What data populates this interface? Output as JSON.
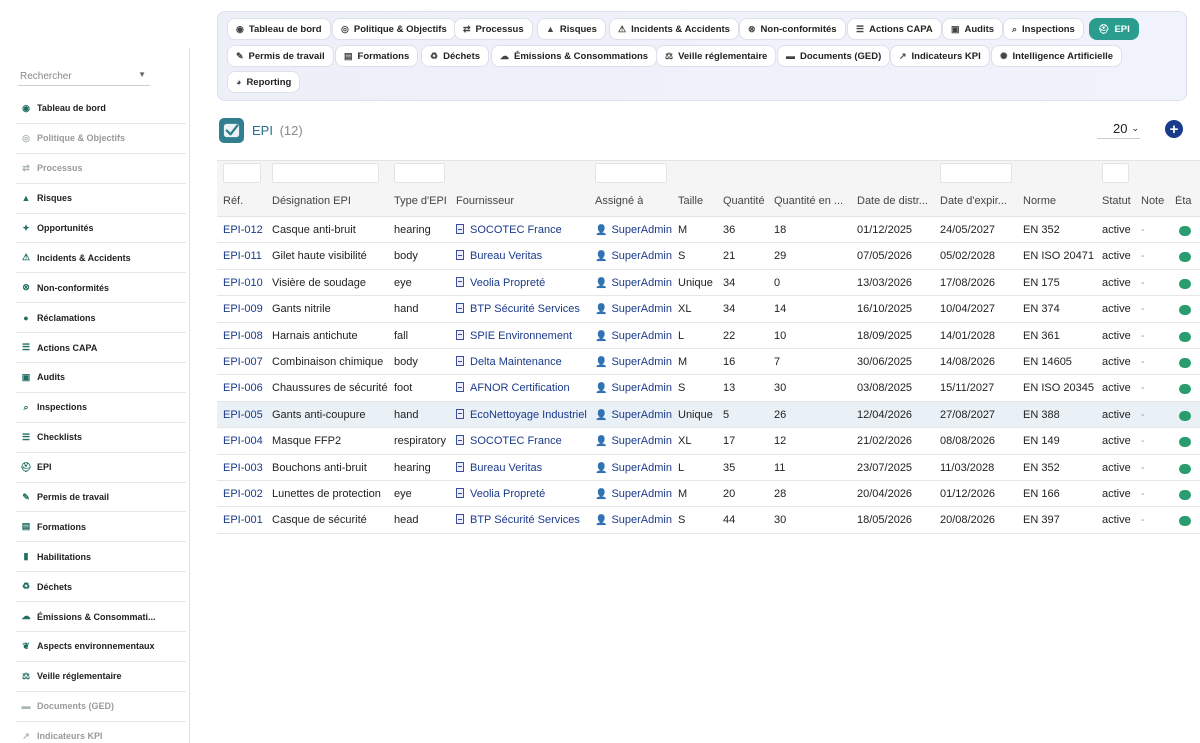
{
  "nav": {
    "items": [
      {
        "label": "Tableau de bord",
        "icon": "dashboard-icon",
        "glyph": "◉"
      },
      {
        "label": "Politique & Objectifs",
        "icon": "target-icon",
        "glyph": "◎"
      },
      {
        "label": "Processus",
        "icon": "process-icon",
        "glyph": "⇄"
      },
      {
        "label": "Risques",
        "icon": "warning-icon",
        "glyph": "▲"
      },
      {
        "label": "Incidents & Accidents",
        "icon": "incident-icon",
        "glyph": "⚠"
      },
      {
        "label": "Non-conformités",
        "icon": "x-circle-icon",
        "glyph": "⊗"
      },
      {
        "label": "Actions CAPA",
        "icon": "list-icon",
        "glyph": "☰"
      },
      {
        "label": "Audits",
        "icon": "clipboard-icon",
        "glyph": "▣"
      },
      {
        "label": "Inspections",
        "icon": "search-icon",
        "glyph": "⌕"
      },
      {
        "label": "EPI",
        "icon": "helmet-icon",
        "glyph": "⛑"
      },
      {
        "label": "Permis de travail",
        "icon": "permit-icon",
        "glyph": "✎"
      },
      {
        "label": "Formations",
        "icon": "training-icon",
        "glyph": "▤"
      },
      {
        "label": "Déchets",
        "icon": "recycle-icon",
        "glyph": "♻"
      },
      {
        "label": "Émissions & Consommations",
        "icon": "cloud-icon",
        "glyph": "☁"
      },
      {
        "label": "Veille réglementaire",
        "icon": "scale-icon",
        "glyph": "⚖"
      },
      {
        "label": "Documents (GED)",
        "icon": "folder-icon",
        "glyph": "▬"
      },
      {
        "label": "Indicateurs KPI",
        "icon": "chart-icon",
        "glyph": "↗"
      },
      {
        "label": "Intelligence Artificielle",
        "icon": "ai-icon",
        "glyph": "✺"
      },
      {
        "label": "Reporting",
        "icon": "report-icon",
        "glyph": "◕"
      }
    ],
    "active": "EPI"
  },
  "sidebar": {
    "search_placeholder": "Rechercher",
    "items": [
      {
        "label": "Tableau de bord",
        "icon": "dashboard-icon",
        "glyph": "◉",
        "muted": false
      },
      {
        "label": "Politique & Objectifs",
        "icon": "target-icon",
        "glyph": "◎",
        "muted": true
      },
      {
        "label": "Processus",
        "icon": "process-icon",
        "glyph": "⇄",
        "muted": true
      },
      {
        "label": "Risques",
        "icon": "warning-icon",
        "glyph": "▲",
        "muted": false
      },
      {
        "label": "Opportunités",
        "icon": "lightbulb-icon",
        "glyph": "✦",
        "muted": false
      },
      {
        "label": "Incidents & Accidents",
        "icon": "incident-icon",
        "glyph": "⚠",
        "muted": false
      },
      {
        "label": "Non-conformités",
        "icon": "x-circle-icon",
        "glyph": "⊗",
        "muted": false
      },
      {
        "label": "Réclamations",
        "icon": "chat-icon",
        "glyph": "●",
        "muted": false
      },
      {
        "label": "Actions CAPA",
        "icon": "list-icon",
        "glyph": "☰",
        "muted": false
      },
      {
        "label": "Audits",
        "icon": "clipboard-icon",
        "glyph": "▣",
        "muted": false
      },
      {
        "label": "Inspections",
        "icon": "search-icon",
        "glyph": "⌕",
        "muted": false
      },
      {
        "label": "Checklists",
        "icon": "checklist-icon",
        "glyph": "☰",
        "muted": false
      },
      {
        "label": "EPI",
        "icon": "helmet-icon",
        "glyph": "⛑",
        "muted": false
      },
      {
        "label": "Permis de travail",
        "icon": "permit-icon",
        "glyph": "✎",
        "muted": false
      },
      {
        "label": "Formations",
        "icon": "training-icon",
        "glyph": "▤",
        "muted": false
      },
      {
        "label": "Habilitations",
        "icon": "badge-icon",
        "glyph": "▮",
        "muted": false
      },
      {
        "label": "Déchets",
        "icon": "recycle-icon",
        "glyph": "♻",
        "muted": false
      },
      {
        "label": "Émissions & Consommati...",
        "icon": "cloud-icon",
        "glyph": "☁",
        "muted": false
      },
      {
        "label": "Aspects environnementaux",
        "icon": "leaf-icon",
        "glyph": "❦",
        "muted": false
      },
      {
        "label": "Veille réglementaire",
        "icon": "scale-icon",
        "glyph": "⚖",
        "muted": false
      },
      {
        "label": "Documents (GED)",
        "icon": "folder-icon",
        "glyph": "▬",
        "muted": true
      },
      {
        "label": "Indicateurs KPI",
        "icon": "chart-icon",
        "glyph": "↗",
        "muted": true
      }
    ]
  },
  "page": {
    "title": "EPI",
    "count": "(12)",
    "per_page": "20",
    "add_label": "+"
  },
  "table": {
    "headers": [
      "Réf.",
      "Désignation EPI",
      "Type d'EPI",
      "Fournisseur",
      "Assigné à",
      "Taille",
      "Quantité",
      "Quantité en ...",
      "Date de distr...",
      "Date d'expir...",
      "Norme",
      "Statut",
      "Note",
      "Éta"
    ],
    "rows": [
      {
        "ref": "EPI-012",
        "name": "Casque anti-bruit",
        "type": "hearing",
        "supplier": "SOCOTEC France",
        "user": "SuperAdmin",
        "size": "M",
        "qty": "36",
        "qty_stock": "18",
        "dist": "01/12/2025",
        "exp": "24/05/2027",
        "norm": "EN 352",
        "status": "active",
        "note": "-"
      },
      {
        "ref": "EPI-011",
        "name": "Gilet haute visibilité",
        "type": "body",
        "supplier": "Bureau Veritas",
        "user": "SuperAdmin",
        "size": "S",
        "qty": "21",
        "qty_stock": "29",
        "dist": "07/05/2026",
        "exp": "05/02/2028",
        "norm": "EN ISO 20471",
        "status": "active",
        "note": "-"
      },
      {
        "ref": "EPI-010",
        "name": "Visière de soudage",
        "type": "eye",
        "supplier": "Veolia Propreté",
        "user": "SuperAdmin",
        "size": "Unique",
        "qty": "34",
        "qty_stock": "0",
        "dist": "13/03/2026",
        "exp": "17/08/2026",
        "norm": "EN 175",
        "status": "active",
        "note": "-"
      },
      {
        "ref": "EPI-009",
        "name": "Gants nitrile",
        "type": "hand",
        "supplier": "BTP Sécurité Services",
        "user": "SuperAdmin",
        "size": "XL",
        "qty": "34",
        "qty_stock": "14",
        "dist": "16/10/2025",
        "exp": "10/04/2027",
        "norm": "EN 374",
        "status": "active",
        "note": "-"
      },
      {
        "ref": "EPI-008",
        "name": "Harnais antichute",
        "type": "fall",
        "supplier": "SPIE Environnement",
        "user": "SuperAdmin",
        "size": "L",
        "qty": "22",
        "qty_stock": "10",
        "dist": "18/09/2025",
        "exp": "14/01/2028",
        "norm": "EN 361",
        "status": "active",
        "note": "-"
      },
      {
        "ref": "EPI-007",
        "name": "Combinaison chimique",
        "type": "body",
        "supplier": "Delta Maintenance",
        "user": "SuperAdmin",
        "size": "M",
        "qty": "16",
        "qty_stock": "7",
        "dist": "30/06/2025",
        "exp": "14/08/2026",
        "norm": "EN 14605",
        "status": "active",
        "note": "-"
      },
      {
        "ref": "EPI-006",
        "name": "Chaussures de sécurité",
        "type": "foot",
        "supplier": "AFNOR Certification",
        "user": "SuperAdmin",
        "size": "S",
        "qty": "13",
        "qty_stock": "30",
        "dist": "03/08/2025",
        "exp": "15/11/2027",
        "norm": "EN ISO 20345",
        "status": "active",
        "note": "-"
      },
      {
        "ref": "EPI-005",
        "name": "Gants anti-coupure",
        "type": "hand",
        "supplier": "EcoNettoyage Industriel",
        "user": "SuperAdmin",
        "size": "Unique",
        "qty": "5",
        "qty_stock": "26",
        "dist": "12/04/2026",
        "exp": "27/08/2027",
        "norm": "EN 388",
        "status": "active",
        "note": "-"
      },
      {
        "ref": "EPI-004",
        "name": "Masque FFP2",
        "type": "respiratory",
        "supplier": "SOCOTEC France",
        "user": "SuperAdmin",
        "size": "XL",
        "qty": "17",
        "qty_stock": "12",
        "dist": "21/02/2026",
        "exp": "08/08/2026",
        "norm": "EN 149",
        "status": "active",
        "note": "-"
      },
      {
        "ref": "EPI-003",
        "name": "Bouchons anti-bruit",
        "type": "hearing",
        "supplier": "Bureau Veritas",
        "user": "SuperAdmin",
        "size": "L",
        "qty": "35",
        "qty_stock": "11",
        "dist": "23/07/2025",
        "exp": "11/03/2028",
        "norm": "EN 352",
        "status": "active",
        "note": "-"
      },
      {
        "ref": "EPI-002",
        "name": "Lunettes de protection",
        "type": "eye",
        "supplier": "Veolia Propreté",
        "user": "SuperAdmin",
        "size": "M",
        "qty": "20",
        "qty_stock": "28",
        "dist": "20/04/2026",
        "exp": "01/12/2026",
        "norm": "EN 166",
        "status": "active",
        "note": "-"
      },
      {
        "ref": "EPI-001",
        "name": "Casque de sécurité",
        "type": "head",
        "supplier": "BTP Sécurité Services",
        "user": "SuperAdmin",
        "size": "S",
        "qty": "44",
        "qty_stock": "30",
        "dist": "18/05/2026",
        "exp": "20/08/2026",
        "norm": "EN 397",
        "status": "active",
        "note": "-"
      }
    ],
    "highlighted_ref": "EPI-005"
  },
  "colors": {
    "accent": "#2a9d8f",
    "link": "#1a3a8a",
    "status_on": "#2a9d6f"
  }
}
